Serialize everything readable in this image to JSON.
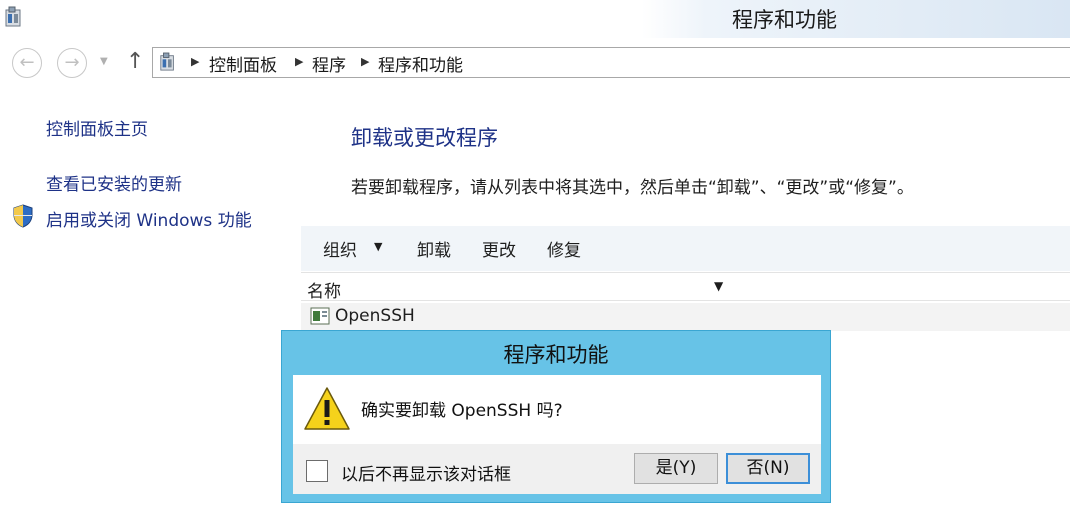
{
  "window": {
    "title": "程序和功能"
  },
  "breadcrumb": [
    "控制面板",
    "程序",
    "程序和功能"
  ],
  "left_pane": {
    "links": [
      "控制面板主页",
      "查看已安装的更新",
      "启用或关闭 Windows 功能"
    ]
  },
  "main": {
    "title": "卸载或更改程序",
    "description": "若要卸载程序，请从列表中将其选中，然后单击“卸载”、“更改”或“修复”。"
  },
  "toolbar": {
    "organize": "组织",
    "uninstall": "卸载",
    "change": "更改",
    "repair": "修复"
  },
  "list": {
    "column_header": "名称",
    "rows": [
      "OpenSSH"
    ]
  },
  "dialog": {
    "title": "程序和功能",
    "message": "确实要卸载 OpenSSH 吗?",
    "checkbox_label": "以后不再显示该对话框",
    "yes_label": "是(Y)",
    "no_label": "否(N)"
  },
  "colors": {
    "link": "#1e3287",
    "dialog_frame": "#67c3e7",
    "toolbar_bg": "#f1f5f9"
  },
  "icons": [
    "control-panel-icon",
    "back-arrow-icon",
    "forward-arrow-icon",
    "up-arrow-icon",
    "shield-icon",
    "program-icon",
    "warning-icon"
  ]
}
